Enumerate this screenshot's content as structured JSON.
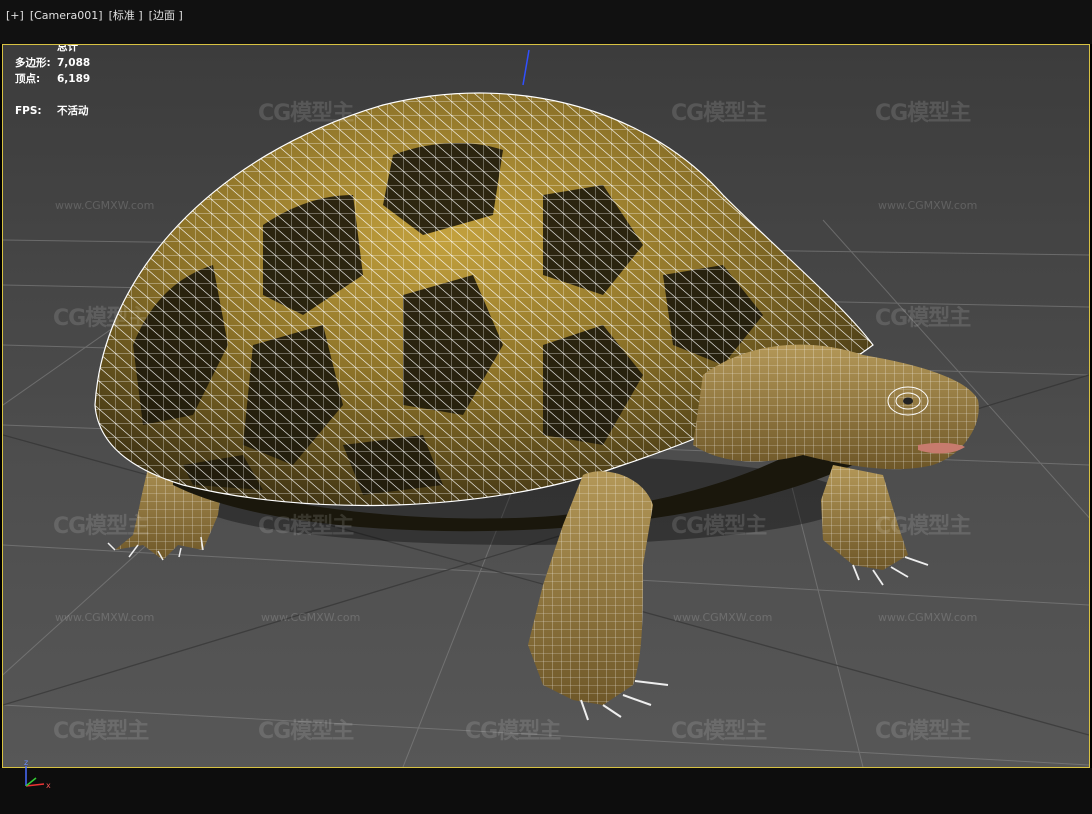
{
  "viewport_menu": {
    "plus": "[+]",
    "camera": "[Camera001]",
    "shading": "[标准 ]",
    "edges": "[边面 ]"
  },
  "stats": {
    "header": "总计",
    "polygons_label": "多边形:",
    "polygons_value": "7,088",
    "vertices_label": "顶点:",
    "vertices_value": "6,189",
    "fps_label": "FPS:",
    "fps_value": "不活动"
  },
  "watermark": {
    "logo": "CG模型主",
    "url": "www.CGMXW.com"
  },
  "gizmo": {
    "z": "z",
    "x": "x"
  },
  "colors": {
    "viewport_border": "#d8c242",
    "wireframe": "#ffffff",
    "shell_dark": "#2a2410",
    "shell_yellow": "#c9a640",
    "skin": "#a08040"
  }
}
